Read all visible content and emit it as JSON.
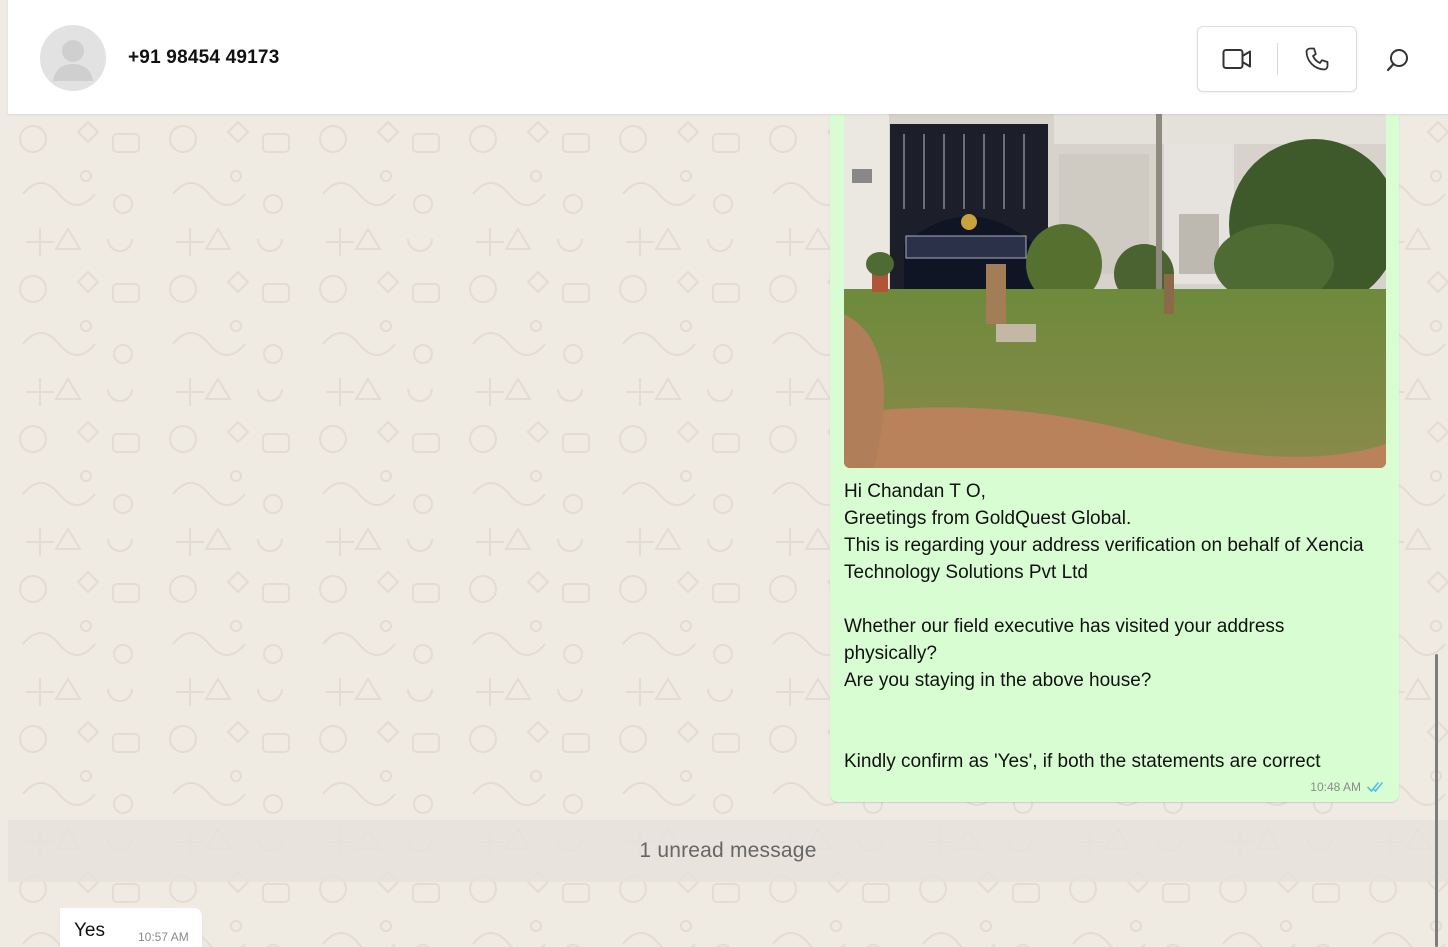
{
  "header": {
    "contact_name": "+91 98454 49173",
    "avatar_icon": "user-silhouette-icon",
    "video_call_icon": "video-camera-icon",
    "voice_call_icon": "phone-icon",
    "search_icon": "search-icon"
  },
  "messages": {
    "outgoing": {
      "photo_icon": "house-photo",
      "text": "Hi Chandan T O,\nGreetings from GoldQuest Global.\nThis is regarding your address verification on behalf of Xencia Technology Solutions Pvt Ltd\n\nWhether our field executive has visited your address physically?\nAre you staying in the above house?\n\n\nKindly confirm as 'Yes', if both the statements are correct",
      "time": "10:48 AM",
      "status_icon": "double-check-read-icon"
    },
    "unread_label": "1 unread message",
    "incoming": {
      "text": "Yes",
      "time": "10:57 AM"
    }
  },
  "colors": {
    "outgoing_bubble": "#d9fdd3",
    "incoming_bubble": "#ffffff",
    "wallpaper": "#efeae2",
    "read_tick": "#53bdeb"
  }
}
